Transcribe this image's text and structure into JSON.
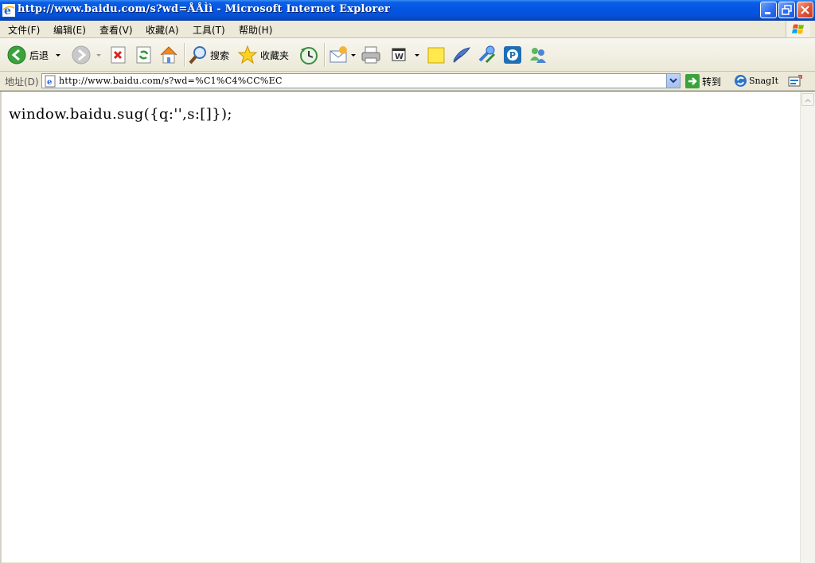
{
  "window": {
    "title": "http://www.baidu.com/s?wd=ÅÅÌì - Microsoft Internet Explorer",
    "buttons": {
      "minimize": "minimize",
      "maximize": "restore",
      "close": "close"
    }
  },
  "menubar": {
    "items": [
      "文件(F)",
      "编辑(E)",
      "查看(V)",
      "收藏(A)",
      "工具(T)",
      "帮助(H)"
    ]
  },
  "toolbar": {
    "back_label": "后退",
    "search_label": "搜索",
    "favorites_label": "收藏夹"
  },
  "addressbar": {
    "label": "地址(D)",
    "url": "http://www.baidu.com/s?wd=%C1%C4%CC%EC",
    "go_label": "转到",
    "snagit_label": "SnagIt"
  },
  "content": {
    "text": "window.baidu.sug({q:'',s:[]});"
  },
  "colors": {
    "titlebar": "#0554e3",
    "chrome": "#ece9d8",
    "close_button": "#e0543a"
  }
}
